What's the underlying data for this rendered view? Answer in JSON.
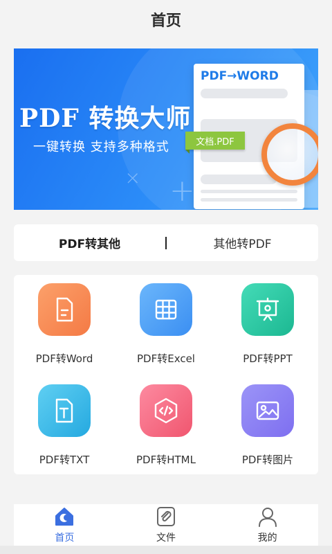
{
  "header": {
    "title": "首页"
  },
  "banner": {
    "title": "PDF 转换大师",
    "subtitle": "一键转换  支持多种格式",
    "doc_heading": "PDF→WORD",
    "tag_text": "文档.PDF"
  },
  "tabs": [
    {
      "label": "PDF转其他",
      "active": true
    },
    {
      "label": "其他转PDF",
      "active": false
    }
  ],
  "tools": [
    {
      "label": "PDF转Word",
      "icon": "document-icon",
      "color": "#f8844a"
    },
    {
      "label": "PDF转Excel",
      "icon": "table-icon",
      "color": "#4a9ff5"
    },
    {
      "label": "PDF转PPT",
      "icon": "presentation-icon",
      "color": "#27c9a3"
    },
    {
      "label": "PDF转TXT",
      "icon": "text-file-icon",
      "color": "#35b6ea"
    },
    {
      "label": "PDF转HTML",
      "icon": "code-icon",
      "color": "#f76b84"
    },
    {
      "label": "PDF转图片",
      "icon": "image-icon",
      "color": "#8a7df2"
    }
  ],
  "bottom_nav": [
    {
      "label": "首页",
      "icon": "home-icon",
      "active": true
    },
    {
      "label": "文件",
      "icon": "paperclip-icon",
      "active": false
    },
    {
      "label": "我的",
      "icon": "user-icon",
      "active": false
    }
  ],
  "colors": {
    "accent": "#3b6fe0",
    "banner_blue": "#1a6ff0",
    "tag_green": "#8dc63f",
    "magnifier_orange": "#f2843d"
  }
}
